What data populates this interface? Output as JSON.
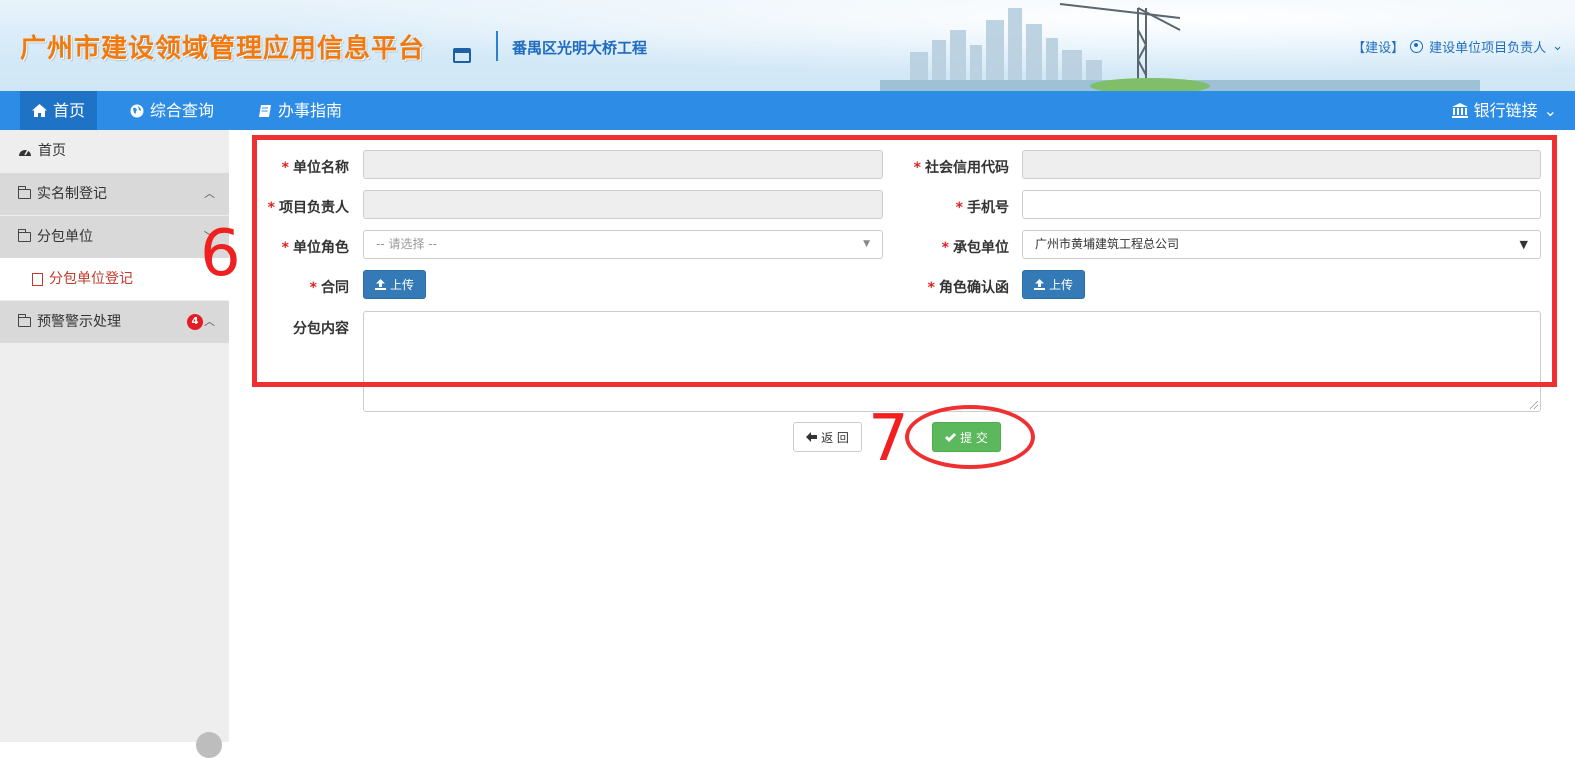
{
  "header": {
    "app_title": "广州市建设领域管理应用信息平台",
    "project_name": "番禺区光明大桥工程",
    "role_tag": "【建设】",
    "user_label": "建设单位项目负责人",
    "user_caret": "⌄"
  },
  "nav": {
    "items": [
      {
        "label": "首页",
        "icon": "home-icon"
      },
      {
        "label": "综合查询",
        "icon": "globe-icon"
      },
      {
        "label": "办事指南",
        "icon": "book-icon"
      }
    ],
    "bank_label": "银行链接",
    "bank_caret": "⌄"
  },
  "sidebar": {
    "items": [
      {
        "label": "首页",
        "icon": "dashboard-icon"
      },
      {
        "label": "实名制登记",
        "icon": "folder-icon"
      },
      {
        "label": "分包单位",
        "icon": "folder-open-icon"
      },
      {
        "label": "分包单位登记",
        "icon": "file-icon"
      },
      {
        "label": "预警警示处理",
        "icon": "folder-icon",
        "badge": "4"
      }
    ]
  },
  "form": {
    "unit_name_label": "单位名称",
    "credit_code_label": "社会信用代码",
    "project_manager_label": "项目负责人",
    "phone_label": "手机号",
    "unit_role_label": "单位角色",
    "unit_role_placeholder": "-- 请选择 --",
    "contractor_label": "承包单位",
    "contractor_value": "广州市黄埔建筑工程总公司",
    "contract_label": "合同",
    "role_confirm_label": "角色确认函",
    "upload_label": "上传",
    "subcontract_content_label": "分包内容",
    "required_mark": "*"
  },
  "actions": {
    "back_label": "返 回",
    "submit_label": "提 交"
  },
  "annotations": {
    "step6": "6",
    "step7": "7"
  },
  "colors": {
    "nav_bg": "#2d8ce6",
    "title_orange": "#f07a10",
    "upload_blue": "#337ab7",
    "submit_green": "#5cb85c",
    "annotation_red": "#f03030"
  }
}
